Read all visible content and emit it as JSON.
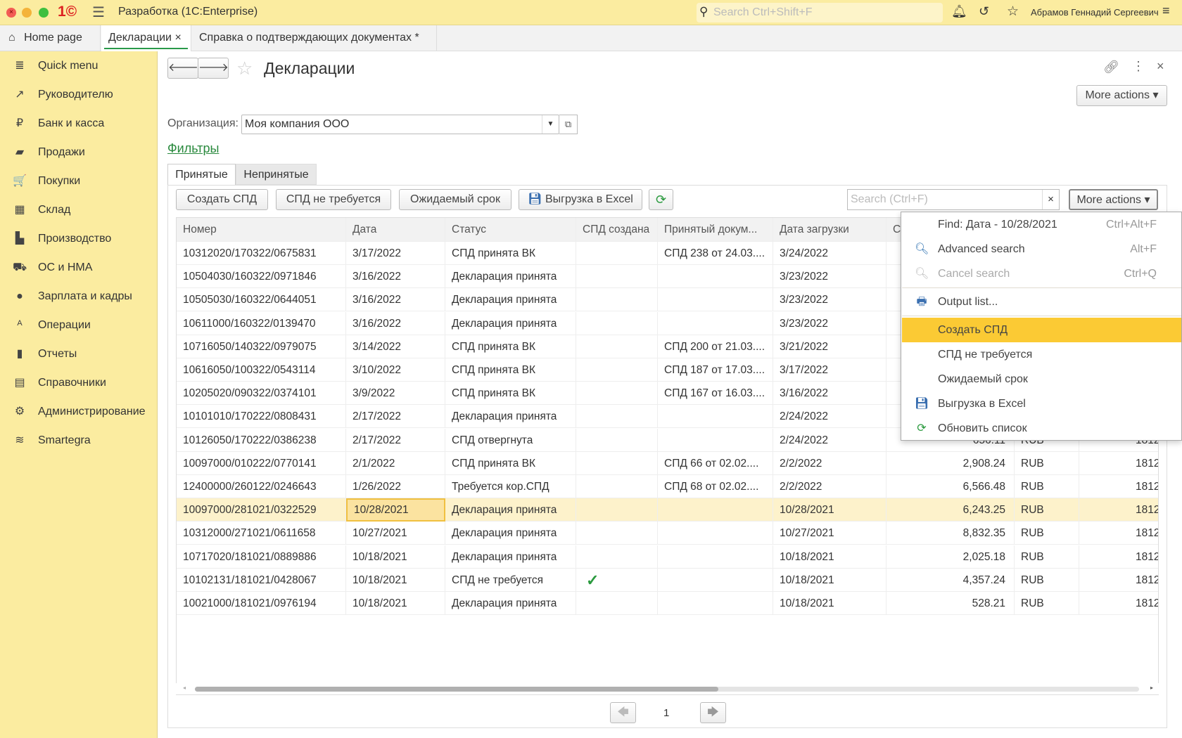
{
  "titlebar": {
    "app_title": "Разработка  (1C:Enterprise)",
    "search_placeholder": "Search Ctrl+Shift+F",
    "user": "Абрамов Геннадий Сергеевич"
  },
  "tabs": [
    {
      "label": "Home page"
    },
    {
      "label": "Декларации",
      "close": "×"
    },
    {
      "label": "Справка о подтверждающих документах *",
      "close": "×"
    }
  ],
  "sidebar": {
    "items": [
      {
        "label": "Quick menu",
        "icon": "≣"
      },
      {
        "label": "Руководителю",
        "icon": "↗"
      },
      {
        "label": "Банк и касса",
        "icon": "₽"
      },
      {
        "label": "Продажи",
        "icon": "▰"
      },
      {
        "label": "Покупки",
        "icon": "🛒"
      },
      {
        "label": "Склад",
        "icon": "▦"
      },
      {
        "label": "Производство",
        "icon": "▙"
      },
      {
        "label": "ОС и НМА",
        "icon": "⛟"
      },
      {
        "label": "Зарплата и кадры",
        "icon": "●"
      },
      {
        "label": "Операции",
        "icon": "ᴬ"
      },
      {
        "label": "Отчеты",
        "icon": "▮"
      },
      {
        "label": "Справочники",
        "icon": "▤"
      },
      {
        "label": "Администрирование",
        "icon": "⚙"
      },
      {
        "label": "Smartegra",
        "icon": "≋"
      }
    ]
  },
  "form": {
    "title": "Декларации",
    "more_actions": "More actions",
    "org_label": "Организация:",
    "org_value": "Моя компания ООО",
    "filters_link": "Фильтры",
    "subtabs": [
      "Принятые",
      "Непринятые"
    ],
    "toolbar": {
      "create": "Создать СПД",
      "not_required": "СПД не требуется",
      "expected": "Ожидаемый срок",
      "excel": "Выгрузка в Excel",
      "search_placeholder": "Search (Ctrl+F)",
      "clear": "×",
      "more_actions": "More actions"
    }
  },
  "table": {
    "columns": [
      "Номер",
      "Дата",
      "Статус",
      "СПД создана",
      "Принятый докум...",
      "Дата загрузки",
      "С",
      "",
      "",
      ""
    ],
    "rows": [
      [
        "10312020/170322/0675831",
        "3/17/2022",
        "СПД принята ВК",
        "",
        "СПД 238 от 24.03....",
        "3/24/2022",
        "",
        "",
        "",
        ""
      ],
      [
        "10504030/160322/0971846",
        "3/16/2022",
        "Декларация принята",
        "",
        "",
        "3/23/2022",
        "",
        "",
        "",
        ""
      ],
      [
        "10505030/160322/0644051",
        "3/16/2022",
        "Декларация принята",
        "",
        "",
        "3/23/2022",
        "",
        "",
        "",
        ""
      ],
      [
        "10611000/160322/0139470",
        "3/16/2022",
        "Декларация принята",
        "",
        "",
        "3/23/2022",
        "",
        "",
        "",
        ""
      ],
      [
        "10716050/140322/0979075",
        "3/14/2022",
        "СПД принята ВК",
        "",
        "СПД 200 от 21.03....",
        "3/21/2022",
        "",
        "",
        "",
        ""
      ],
      [
        "10616050/100322/0543114",
        "3/10/2022",
        "СПД принята ВК",
        "",
        "СПД 187 от 17.03....",
        "3/17/2022",
        "",
        "",
        "",
        ""
      ],
      [
        "10205020/090322/0374101",
        "3/9/2022",
        "СПД принята ВК",
        "",
        "СПД 167 от 16.03....",
        "3/16/2022",
        "",
        "",
        "",
        ""
      ],
      [
        "10101010/170222/0808431",
        "2/17/2022",
        "Декларация принята",
        "",
        "",
        "2/24/2022",
        "",
        "",
        "",
        ""
      ],
      [
        "10126050/170222/0386238",
        "2/17/2022",
        "СПД отвергнута",
        "",
        "",
        "2/24/2022",
        "",
        "656.11",
        "RUB",
        "1812"
      ],
      [
        "10097000/010222/0770141",
        "2/1/2022",
        "СПД принята ВК",
        "",
        "СПД 66 от 02.02....",
        "2/2/2022",
        "",
        "2,908.24",
        "RUB",
        "1812"
      ],
      [
        "12400000/260122/0246643",
        "1/26/2022",
        "Требуется кор.СПД",
        "",
        "СПД 68 от 02.02....",
        "2/2/2022",
        "",
        "6,566.48",
        "RUB",
        "1812"
      ],
      [
        "10097000/281021/0322529",
        "10/28/2021",
        "Декларация принята",
        "",
        "",
        "10/28/2021",
        "",
        "6,243.25",
        "RUB",
        "1812"
      ],
      [
        "10312000/271021/0611658",
        "10/27/2021",
        "Декларация принята",
        "",
        "",
        "10/27/2021",
        "",
        "8,832.35",
        "RUB",
        "1812"
      ],
      [
        "10717020/181021/0889886",
        "10/18/2021",
        "Декларация принята",
        "",
        "",
        "10/18/2021",
        "",
        "2,025.18",
        "RUB",
        "1812"
      ],
      [
        "10102131/181021/0428067",
        "10/18/2021",
        "СПД не требуется",
        "✓",
        "",
        "10/18/2021",
        "",
        "4,357.24",
        "RUB",
        "1812"
      ],
      [
        "10021000/181021/0976194",
        "10/18/2021",
        "Декларация принята",
        "",
        "",
        "10/18/2021",
        "",
        "528.21",
        "RUB",
        "1812"
      ]
    ],
    "selected_row": 11
  },
  "pagination": {
    "page": "1"
  },
  "context_menu": {
    "items": [
      {
        "label": "Find: Дата - 10/28/2021",
        "shortcut": "Ctrl+Alt+F",
        "icon": ""
      },
      {
        "label": "Advanced search",
        "shortcut": "Alt+F",
        "icon": "search"
      },
      {
        "label": "Cancel search",
        "shortcut": "Ctrl+Q",
        "icon": "cancel-search",
        "disabled": true
      },
      {
        "label": "Output list...",
        "shortcut": "",
        "icon": "printer"
      },
      {
        "label": "Создать СПД",
        "shortcut": "",
        "icon": "",
        "highlighted": true
      },
      {
        "label": "СПД не требуется",
        "shortcut": "",
        "icon": ""
      },
      {
        "label": "Ожидаемый срок",
        "shortcut": "",
        "icon": ""
      },
      {
        "label": "Выгрузка в Excel",
        "shortcut": "",
        "icon": "save"
      },
      {
        "label": "Обновить список",
        "shortcut": "",
        "icon": "refresh"
      }
    ]
  },
  "colors": {
    "accent_yellow": "#fbeca0",
    "highlight": "#fbca34",
    "selected_row": "#fdf2cb",
    "link_green": "#2a8a3e"
  }
}
